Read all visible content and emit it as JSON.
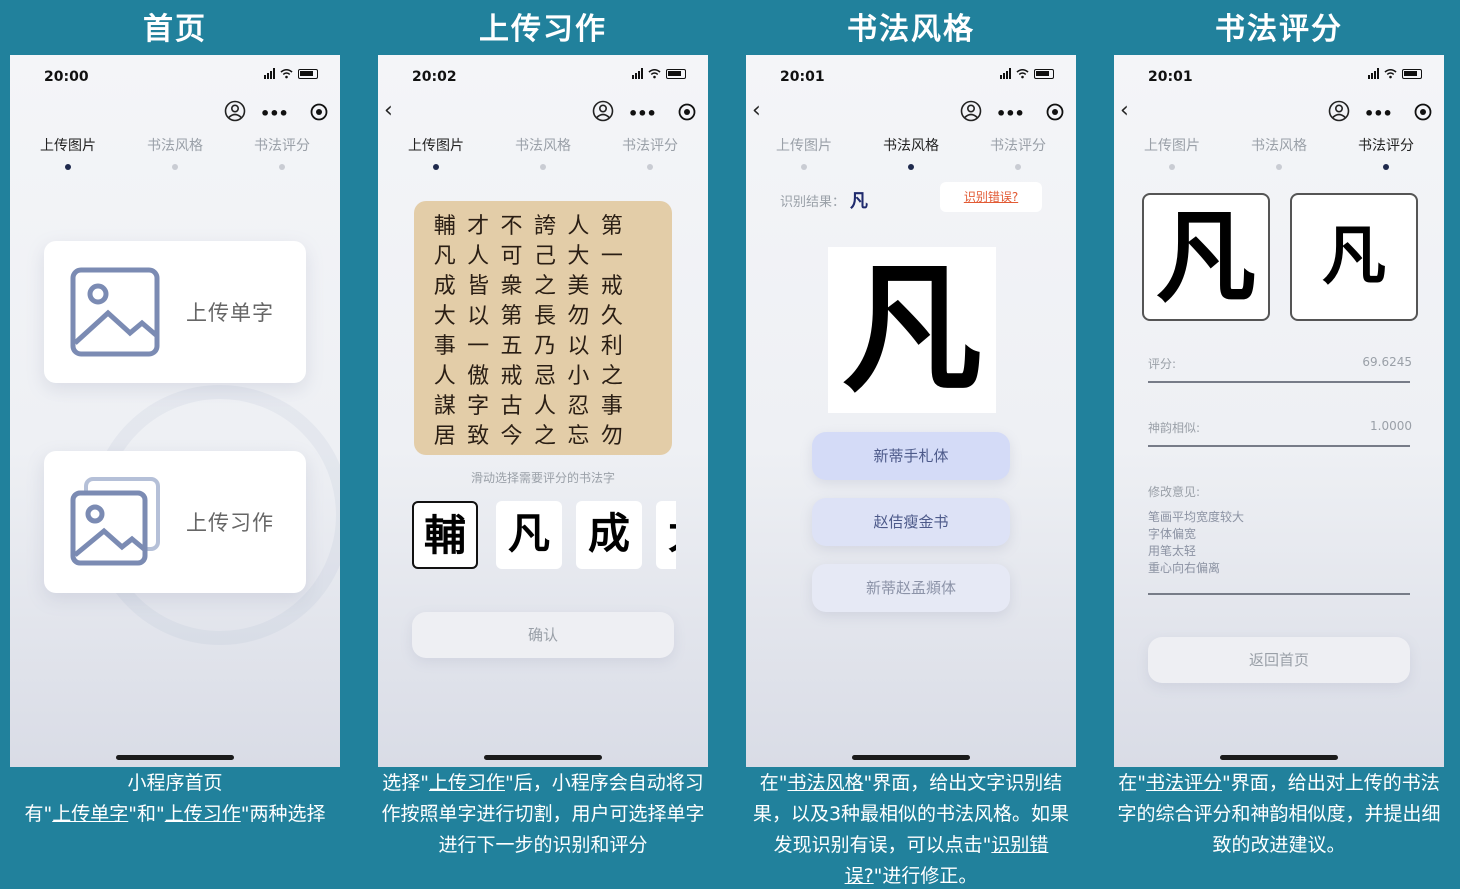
{
  "panels": [
    {
      "title": "首页",
      "time": "20:00"
    },
    {
      "title": "上传习作",
      "time": "20:02"
    },
    {
      "title": "书法风格",
      "time": "20:01"
    },
    {
      "title": "书法评分",
      "time": "20:01"
    }
  ],
  "tabs": [
    "上传图片",
    "书法风格",
    "书法评分"
  ],
  "home": {
    "card1_label": "上传单字",
    "card2_label": "上传习作",
    "caption_line1": "小程序首页",
    "caption_line2_a": "有\"",
    "caption_line2_b": "上传单字",
    "caption_line2_c": "\"和\"",
    "caption_line2_d": "上传习作",
    "caption_line2_e": "\"两种选择"
  },
  "upload": {
    "grid": [
      "輔",
      "才",
      "不",
      "誇",
      "人",
      "第",
      "",
      "凡",
      "人",
      "可",
      "己",
      "大",
      "一",
      "",
      "成",
      "皆",
      "衆",
      "之",
      "美",
      "戒",
      "",
      "大",
      "以",
      "第",
      "長",
      "勿",
      "久",
      "",
      "事",
      "一",
      "五",
      "乃",
      "以",
      "利",
      "",
      "人",
      "傲",
      "戒",
      "忌",
      "小",
      "之",
      "",
      "謀",
      "字",
      "古",
      "人",
      "忍",
      "事",
      "",
      "居",
      "致",
      "今",
      "之",
      "忘",
      "勿",
      ""
    ],
    "hint": "滑动选择需要评分的书法字",
    "chars": [
      "輔",
      "凡",
      "成",
      "大"
    ],
    "confirm": "确认",
    "caption_a": "选择\"",
    "caption_b": "上传习作",
    "caption_c": "\"后，小程序会自动将习作按照单字进行切割，用户可选择单字进行下一步的识别和评分"
  },
  "style": {
    "result_label": "识别结果：",
    "result_char": "凡",
    "error_btn": "识别错误?",
    "big_char": "凡",
    "options": [
      "新蒂手札体",
      "赵佶瘦金书",
      "新蒂赵孟頫体"
    ],
    "caption_a": "在\"",
    "caption_b": "书法风格",
    "caption_c": "\"界面，给出文字识别结果，以及3种最相似的书法风格。如果发现识别有误，可以点击\"",
    "caption_d": "识别错误?",
    "caption_e": "\"进行修正。"
  },
  "score": {
    "char_left": "凡",
    "char_right": "凡",
    "score_label": "评分:",
    "score_value": "69.6245",
    "similar_label": "神韵相似:",
    "similar_value": "1.0000",
    "advice_label": "修改意见:",
    "advice": [
      "笔画平均宽度较大",
      "字体偏宽",
      "用笔太轻",
      "重心向右偏离"
    ],
    "back_btn": "返回首页",
    "caption_a": "在\"",
    "caption_b": "书法评分",
    "caption_c": "\"界面，给出对上传的书法字的综合评分和神韵相似度，并提出细致的改进建议。"
  },
  "colors": {
    "background": "#21819c",
    "active_dot": "#1f2a4d",
    "error": "#e25a34"
  }
}
